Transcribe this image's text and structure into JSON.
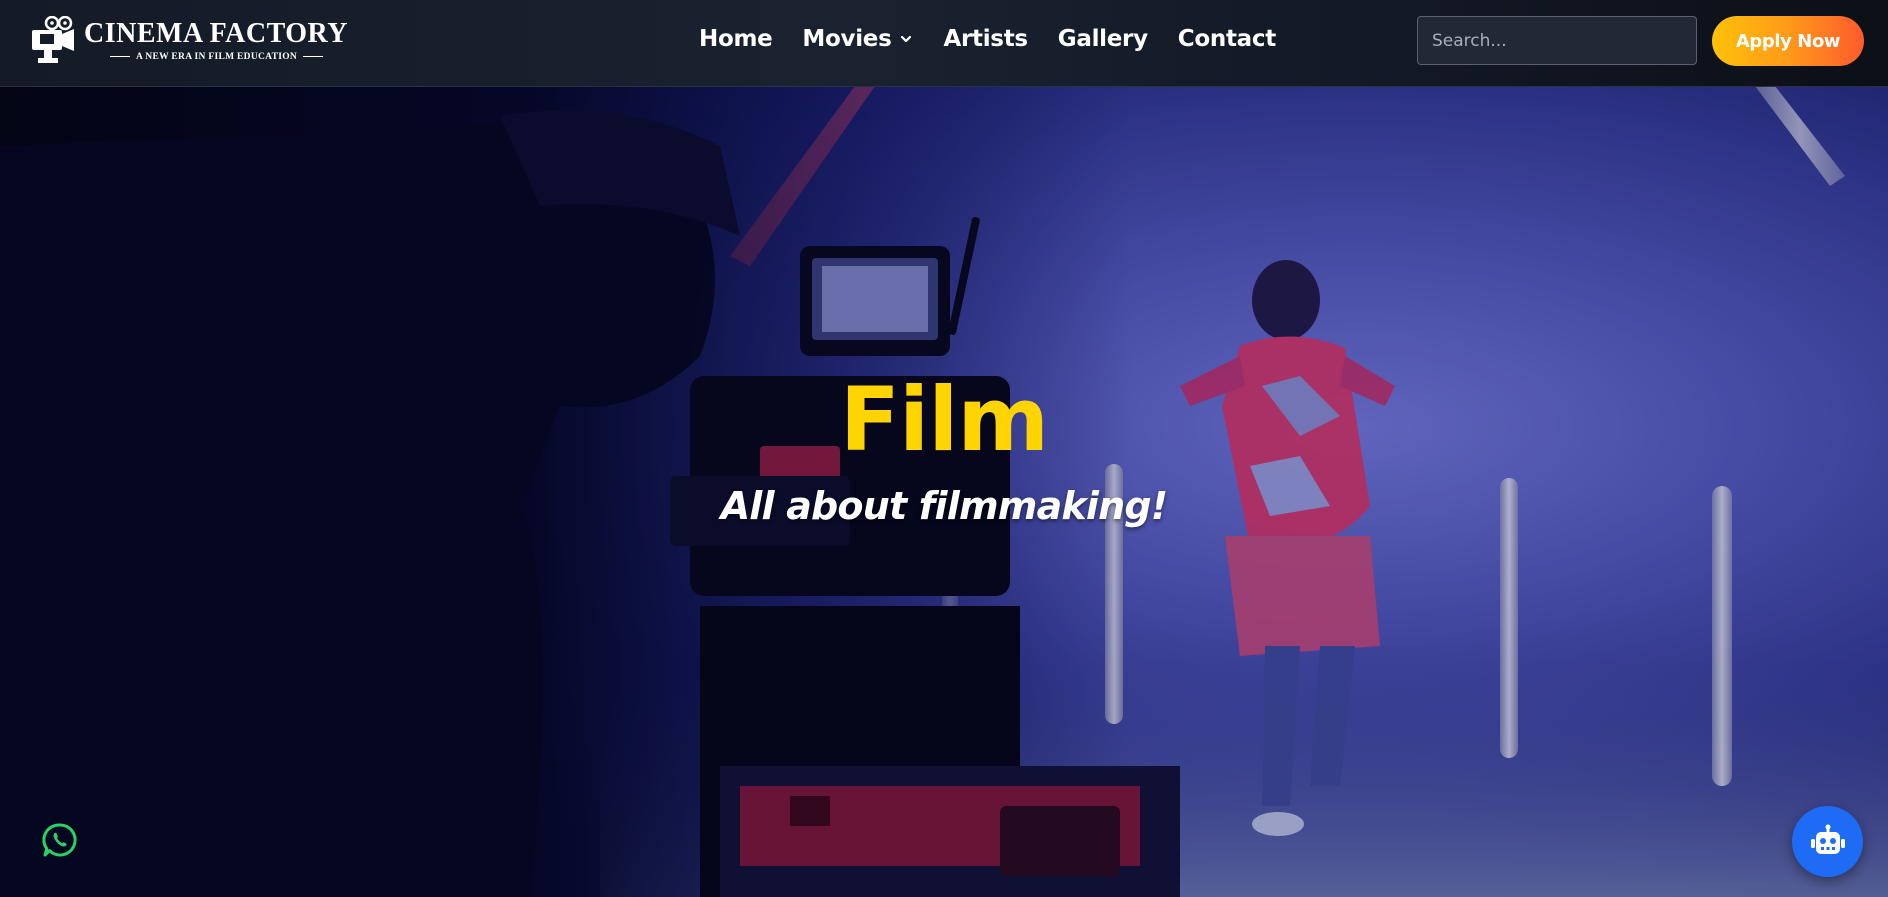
{
  "brand": {
    "name": "CINEMA FACTORY",
    "tagline": "A NEW ERA IN FILM EDUCATION"
  },
  "nav": {
    "items": [
      {
        "label": "Home"
      },
      {
        "label": "Movies",
        "has_dropdown": true
      },
      {
        "label": "Artists"
      },
      {
        "label": "Gallery"
      },
      {
        "label": "Contact"
      }
    ]
  },
  "search": {
    "placeholder": "Search..."
  },
  "cta": {
    "apply_label": "Apply Now"
  },
  "hero": {
    "title": "Film",
    "subtitle": "All about filmmaking!"
  },
  "floating": {
    "whatsapp_icon": "whatsapp-icon",
    "chatbot_icon": "robot-icon"
  },
  "colors": {
    "accent_yellow": "#ffd400",
    "cta_gradient_start": "#ffc107",
    "cta_gradient_end": "#ff5a2c",
    "chatbot_blue": "#1e6cf5",
    "whatsapp_green": "#25d366"
  }
}
